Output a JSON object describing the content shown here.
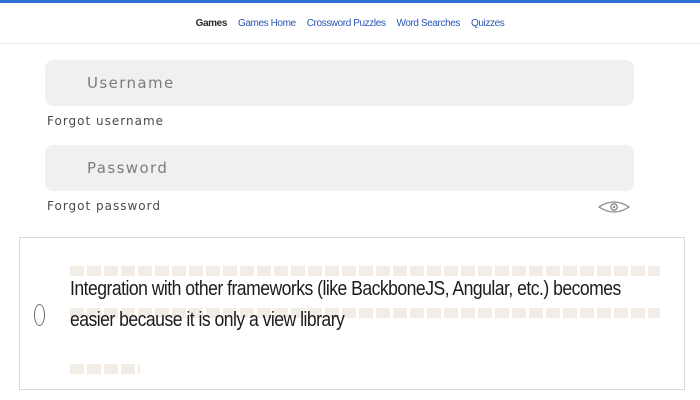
{
  "nav": {
    "items": [
      {
        "label": "Games",
        "active": true
      },
      {
        "label": "Games Home",
        "active": false
      },
      {
        "label": "Crossword Puzzles",
        "active": false
      },
      {
        "label": "Word Searches",
        "active": false
      },
      {
        "label": "Quizzes",
        "active": false
      }
    ]
  },
  "login": {
    "username_placeholder": "Username",
    "forgot_username": "Forgot username",
    "password_placeholder": "Password",
    "forgot_password": "Forgot password",
    "show_password_icon": "eye-icon"
  },
  "quiz": {
    "option_text": "Integration with other frameworks (like BackboneJS, Angular, etc.) becomes easier because it is only a view library",
    "selected": false
  },
  "colors": {
    "accent": "#2f6fd6",
    "link": "#2a55b5",
    "field_bg": "#f0f0f0"
  }
}
